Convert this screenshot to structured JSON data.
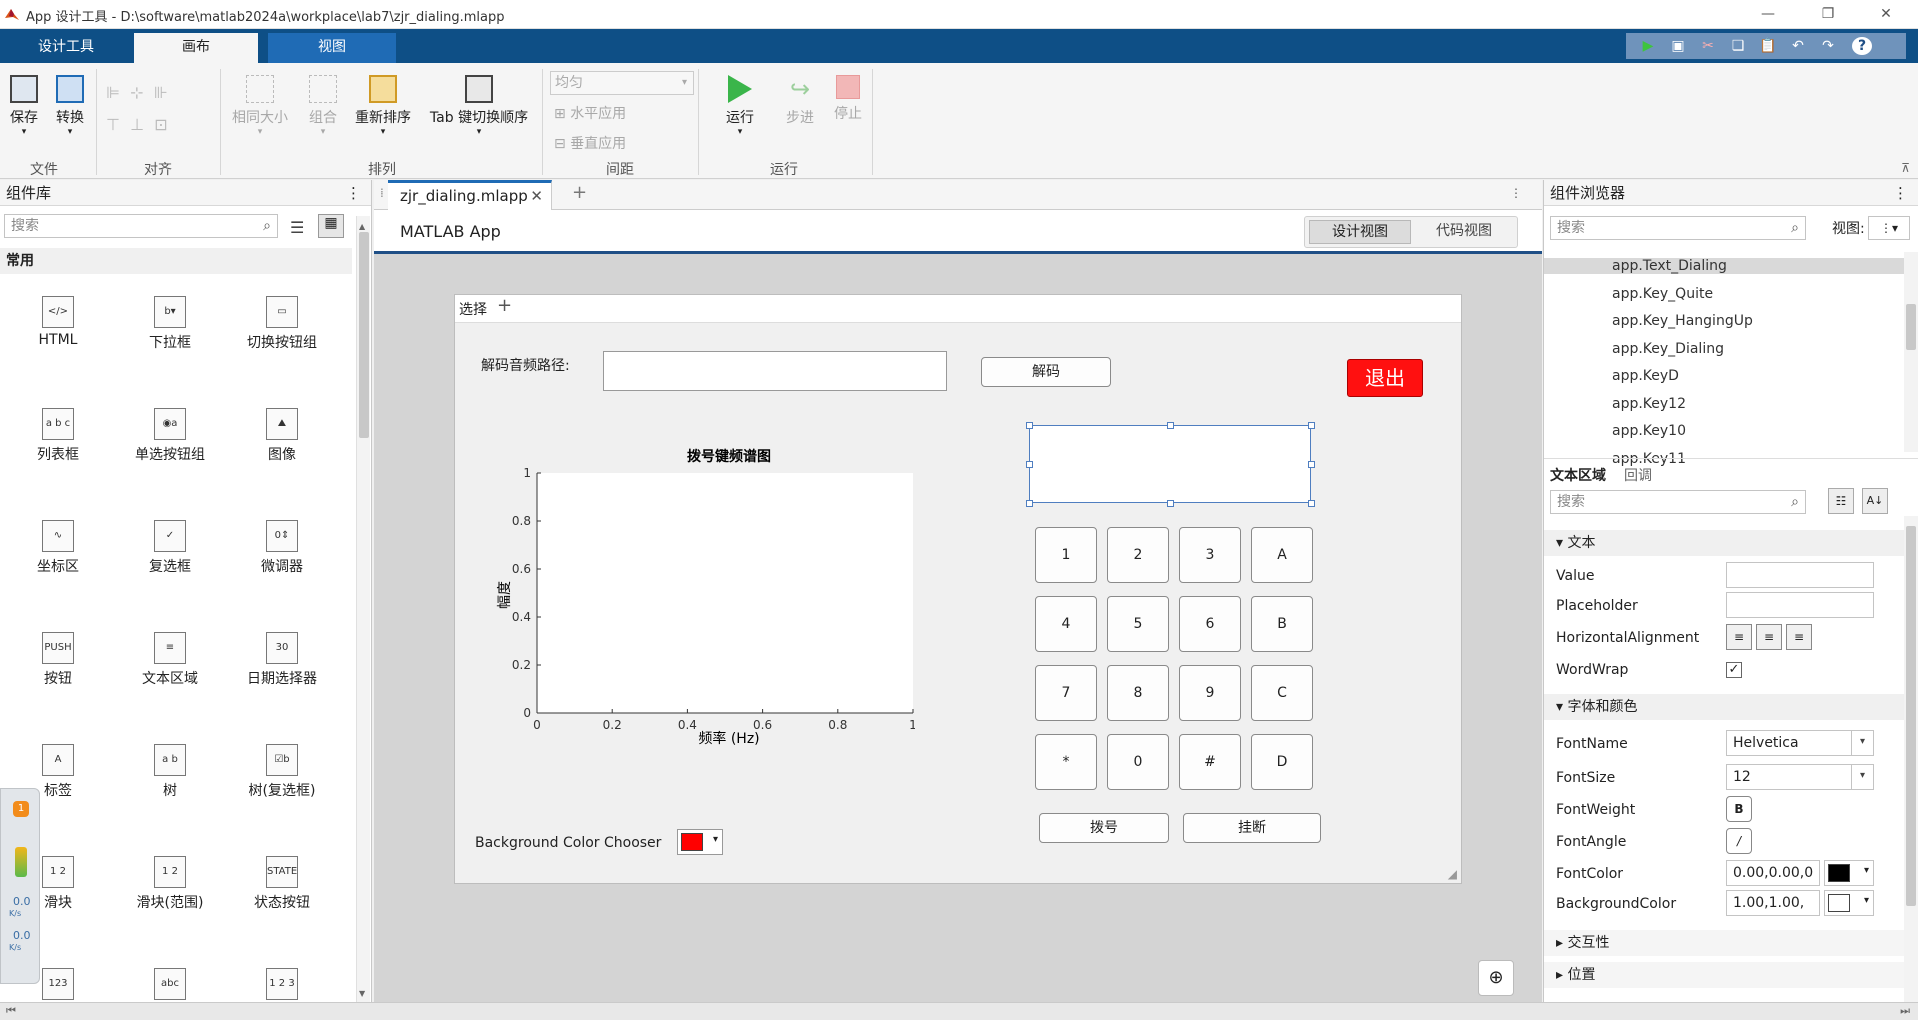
{
  "window": {
    "title": "App 设计工具 - D:\\software\\matlab2024a\\workplace\\lab7\\zjr_dialing.mlapp",
    "controls": [
      "—",
      "❐",
      "✕"
    ]
  },
  "ribbon_tabs": [
    "设计工具",
    "画布",
    "视图"
  ],
  "ribbon": {
    "save": "保存",
    "convert": "转换",
    "group_file": "文件",
    "group_align": "对齐",
    "same_size": "相同大小",
    "combine": "组合",
    "reorder": "重新排序",
    "tab_order": "Tab 键切换顺序",
    "group_arrange": "排列",
    "even_select": "均匀",
    "horiz_apply": "水平应用",
    "vert_apply": "垂直应用",
    "group_spacing": "间距",
    "run": "运行",
    "step": "步进",
    "stop": "停止",
    "group_run": "运行"
  },
  "left_panel": {
    "title": "组件库",
    "search_placeholder": "搜索",
    "section": "常用",
    "components": [
      {
        "label": "HTML",
        "icon": "</>"
      },
      {
        "label": "下拉框",
        "icon": "b▾"
      },
      {
        "label": "切换按钮组",
        "icon": "▭"
      },
      {
        "label": "列表框",
        "icon": "a b c"
      },
      {
        "label": "单选按钮组",
        "icon": "◉a"
      },
      {
        "label": "图像",
        "icon": "⛰"
      },
      {
        "label": "坐标区",
        "icon": "∿"
      },
      {
        "label": "复选框",
        "icon": "✓"
      },
      {
        "label": "微调器",
        "icon": "0⇕"
      },
      {
        "label": "按钮",
        "icon": "PUSH"
      },
      {
        "label": "文本区域",
        "icon": "≡"
      },
      {
        "label": "日期选择器",
        "icon": "30"
      },
      {
        "label": "标签",
        "icon": "A"
      },
      {
        "label": "树",
        "icon": "a b"
      },
      {
        "label": "树(复选框)",
        "icon": "☑b"
      },
      {
        "label": "滑块",
        "icon": "1 2"
      },
      {
        "label": "滑块(范围)",
        "icon": "1 2"
      },
      {
        "label": "状态按钮",
        "icon": "STATE"
      },
      {
        "label": "",
        "icon": "123"
      },
      {
        "label": "",
        "icon": "abc"
      },
      {
        "label": "",
        "icon": "1 2 3"
      }
    ],
    "side_widget": {
      "badge": "1",
      "up": "0.0",
      "down": "0.0",
      "unit": "K/s"
    }
  },
  "document": {
    "tab": "zjr_dialing.mlapp",
    "app_title": "MATLAB App",
    "view_design": "设计视图",
    "view_code": "代码视图"
  },
  "app": {
    "menu_label": "选择",
    "menu_add": "+",
    "path_label": "解码音频路径:",
    "path_value": "",
    "decode_button": "解码",
    "exit_button": "退出",
    "display_value": "",
    "keys": [
      [
        "1",
        "2",
        "3",
        "A"
      ],
      [
        "4",
        "5",
        "6",
        "B"
      ],
      [
        "7",
        "8",
        "9",
        "C"
      ],
      [
        "*",
        "0",
        "#",
        "D"
      ]
    ],
    "dial_button": "拨号",
    "hangup_button": "挂断",
    "bg_chooser_label": "Background Color Chooser",
    "bg_color": "#ff0000"
  },
  "chart_data": {
    "type": "line",
    "title": "拨号键频谱图",
    "xlabel": "频率 (Hz)",
    "ylabel": "幅度",
    "xlim": [
      0,
      1
    ],
    "ylim": [
      0,
      1
    ],
    "xticks": [
      "0",
      "0.2",
      "0.4",
      "0.6",
      "0.8",
      "1"
    ],
    "yticks": [
      "0",
      "0.2",
      "0.4",
      "0.6",
      "0.8",
      "1"
    ],
    "series": [],
    "grid": false
  },
  "right_panel": {
    "title": "组件浏览器",
    "search_placeholder": "搜索",
    "view_label": "视图:",
    "tree": [
      "app.Text_Dialing",
      "app.Key_Quite",
      "app.Key_HangingUp",
      "app.Key_Dialing",
      "app.KeyD",
      "app.Key12",
      "app.Key10",
      "app.Key11"
    ],
    "prop_tabs": [
      "文本区域",
      "回调"
    ],
    "prop_search": "搜索",
    "sec_text": "文本",
    "value_label": "Value",
    "value": "",
    "placeholder_label": "Placeholder",
    "placeholder": "",
    "halign_label": "HorizontalAlignment",
    "wordwrap_label": "WordWrap",
    "sec_font": "字体和颜色",
    "fontname_label": "FontName",
    "fontname": "Helvetica",
    "fontsize_label": "FontSize",
    "fontsize": "12",
    "fontweight_label": "FontWeight",
    "fontweight": "B",
    "fontangle_label": "FontAngle",
    "fontangle": "/",
    "fontcolor_label": "FontColor",
    "fontcolor": "0.00,0.00,0",
    "bgcolor_label": "BackgroundColor",
    "bgcolor": "1.00,1.00,",
    "sec_interact": "交互性",
    "sec_position": "位置",
    "font_swatch": "#000000",
    "bg_swatch": "#ffffff"
  }
}
